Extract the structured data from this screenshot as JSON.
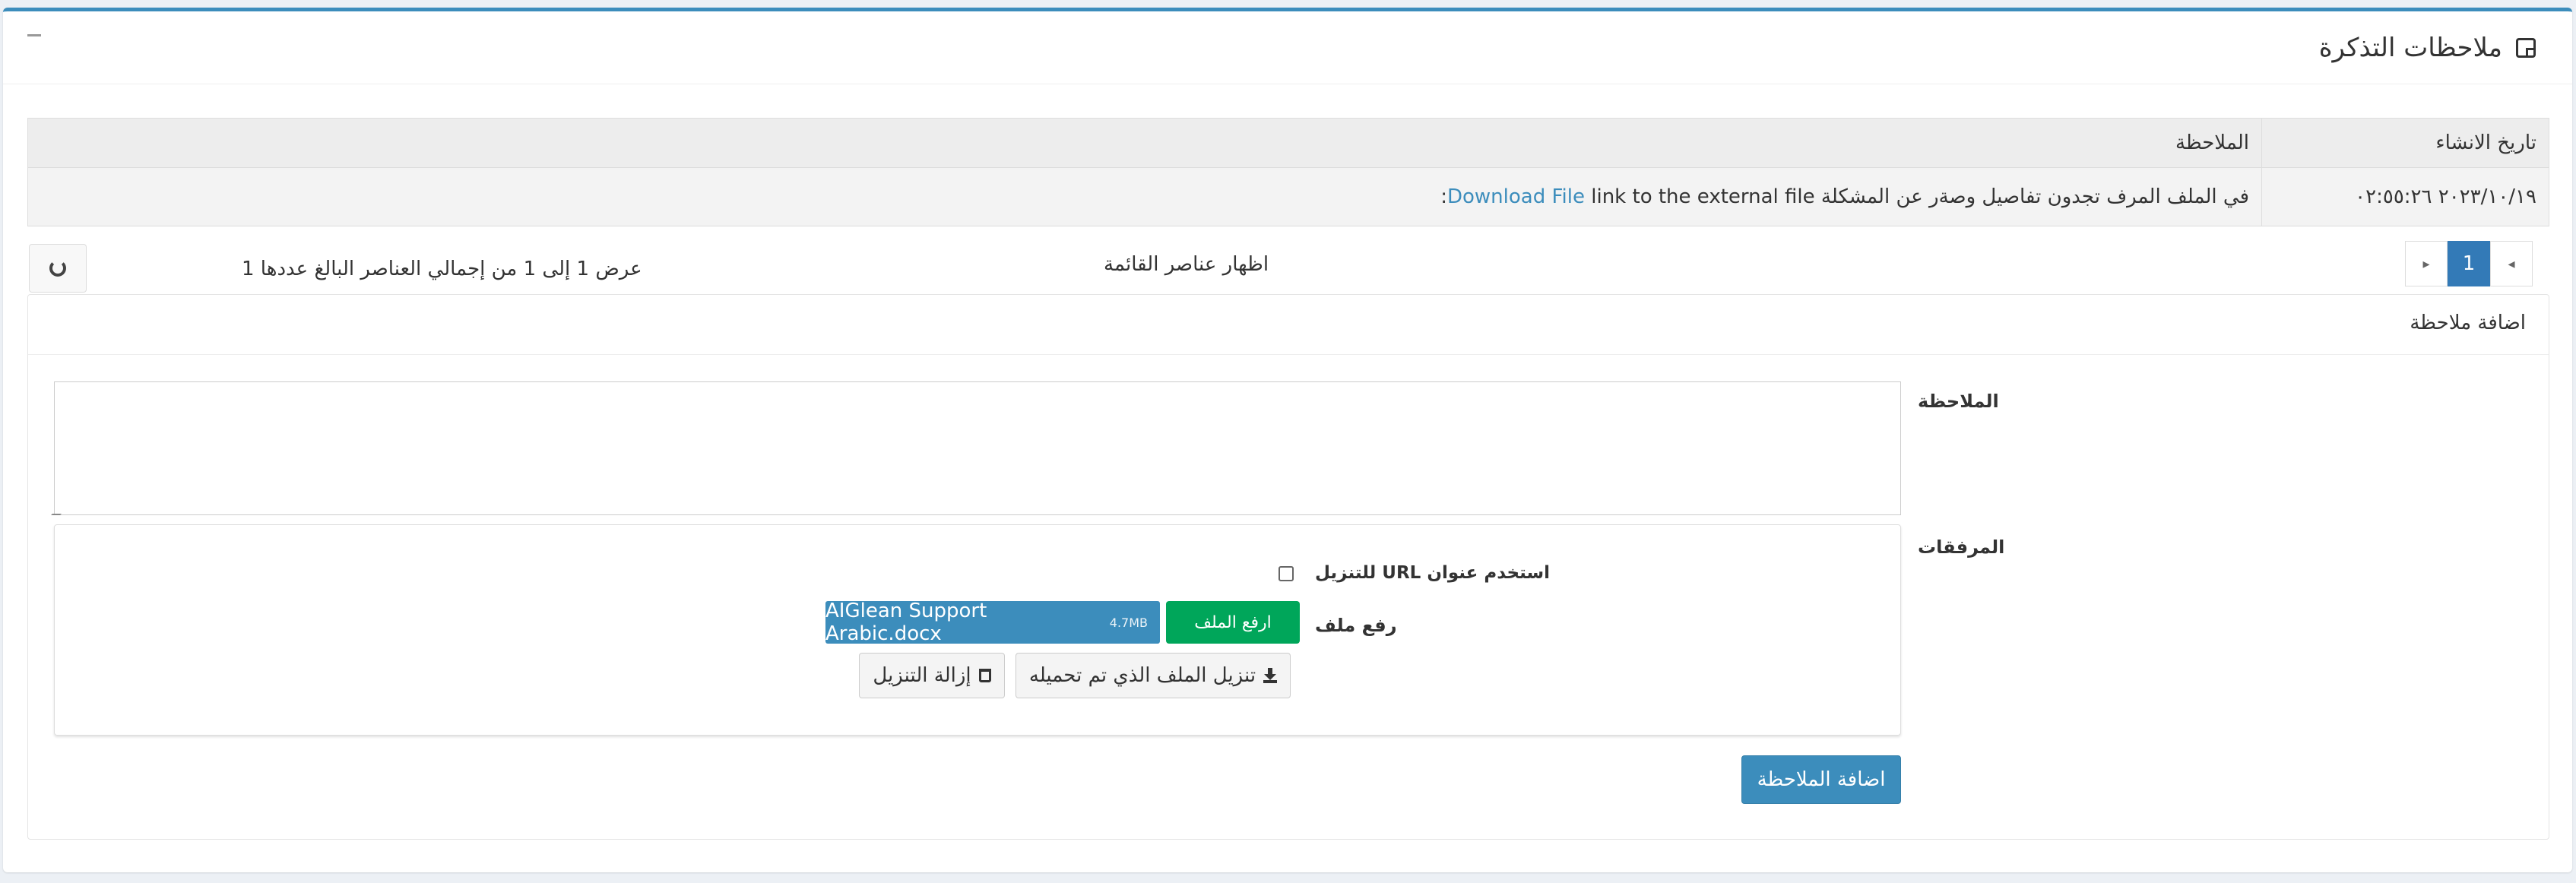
{
  "panel": {
    "title": "ملاحظات التذكرة",
    "icon": "sticky-note-icon",
    "collapse_icon": "minus-icon"
  },
  "notes_table": {
    "columns": [
      "تاريخ الانشاء",
      "الملاحظة"
    ],
    "rows": [
      {
        "date": "٢٠٢٣/١٠/١٩ ٠٢:٥٥:٢٦",
        "note_text": "في الملف المرف تجدون تفاصيل وصةر عن المشكلة",
        "link_text": "Download File",
        "link_suffix": "link to the external file:"
      }
    ]
  },
  "pagination": {
    "prev_icon": "caret-right-icon",
    "current_page": "1",
    "next_icon": "caret-left-icon",
    "list_label": "اظهار عناصر القائمة",
    "summary": "عرض 1 إلى 1 من إجمالي العناصر البالغ عددها 1",
    "refresh_icon": "refresh-icon"
  },
  "add_note": {
    "title": "اضافة ملاحظة",
    "note_label": "الملاحظة",
    "note_value": "",
    "attachments_label": "المرفقات",
    "use_url_label": "استخدم عنوان URL للتنزيل",
    "use_url_checked": false,
    "upload_label": "رفع ملف",
    "upload_button": "ارفع الملف",
    "file_name": "AIGlean Support Arabic.docx",
    "file_size": "4.7MB",
    "download_uploaded": "تنزيل الملف الذي تم تحميله",
    "remove_download": "إزالة التنزيل",
    "submit": "اضافة الملاحظة"
  },
  "colors": {
    "primary": "#3c8dbc",
    "success": "#00a65a",
    "header_bg": "#ededed"
  }
}
